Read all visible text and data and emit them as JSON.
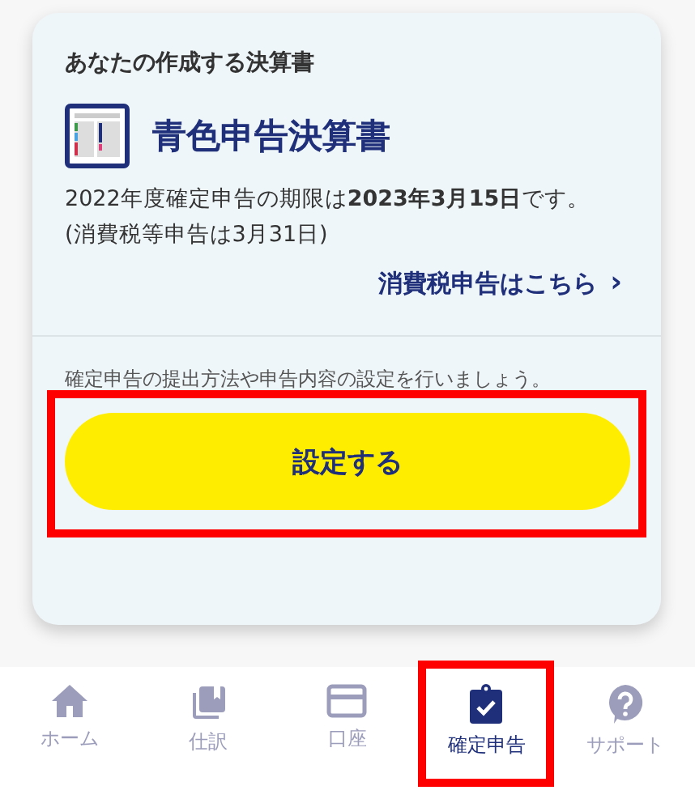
{
  "card": {
    "heading": "あなたの作成する決算書",
    "document_title": "青色申告決算書",
    "deadline_text": "2022年度確定申告の期限は**2023年3月15日**です。",
    "note": "(消費税等申告は3月31日)",
    "link": "消費税申告はこちら",
    "link_chevron": "›",
    "instruction": "確定申告の提出方法や申告内容の設定を行いましょう。",
    "button": "設定する",
    "button_highlighted": true
  },
  "nav": [
    {
      "kind": "home",
      "label": "ホーム",
      "selected": false,
      "highlighted": false
    },
    {
      "kind": "journal",
      "label": "仕訳",
      "selected": false,
      "highlighted": false
    },
    {
      "kind": "account",
      "label": "口座",
      "selected": false,
      "highlighted": false
    },
    {
      "kind": "tax",
      "label": "確定申告",
      "selected": true,
      "highlighted": true
    },
    {
      "kind": "support",
      "label": "サポート",
      "selected": false,
      "highlighted": false
    }
  ]
}
